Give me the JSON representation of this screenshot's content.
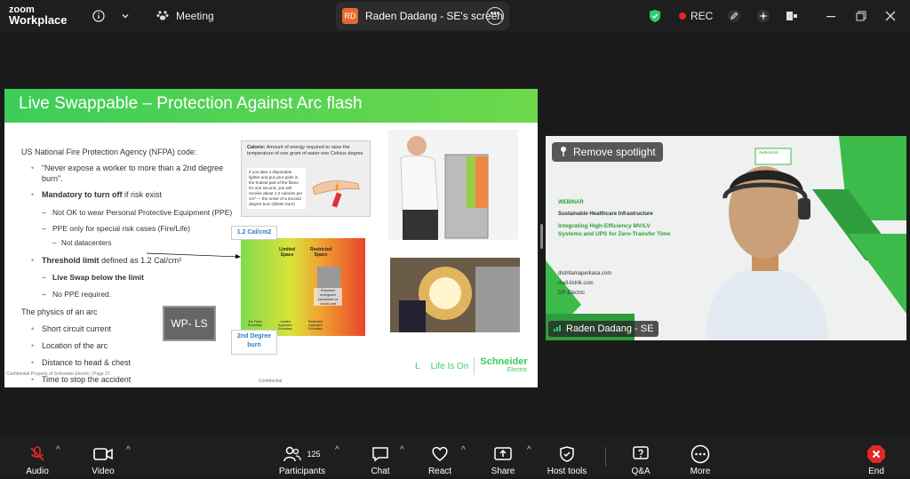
{
  "app": {
    "logo_line1": "zoom",
    "logo_line2": "Workplace",
    "meeting_label": "Meeting"
  },
  "screen_share": {
    "badge": "RD",
    "title": "Raden Dadang - SE's screen"
  },
  "recording": {
    "label": "REC"
  },
  "slide": {
    "title": "Live Swappable – Protection Against Arc flash",
    "lines": {
      "nfpa": "US National Fire Protection Agency (NFPA) code:",
      "never_expose": "“Never expose a worker to more than a 2nd degree",
      "burn": "burn”.",
      "mandatory_bold": "Mandatory",
      "turn_off_bold": "to turn off",
      "turn_off_rest": "if risk exist",
      "not_ok_ppe": "Not OK to wear Personal Protective Equipment (PPE)",
      "ppe_only": "PPE only for special risk cases (Fire/Life)",
      "not_datacenters": "Not datacenters",
      "threshold_bold": "Threshold limit",
      "threshold_rest": "defined as 1.2 Cal/cm²",
      "live_swap": "Live Swap below the limit",
      "no_ppe": "No PPE required.",
      "physics": "The physics of an arc",
      "short_circuit": "Short circuit current",
      "location": "Location of the arc",
      "distance": "Distance to head & chest",
      "time": "Time to stop the accident",
      "confidential_prop": "Confidential Property of Schneider Electric | Page 27",
      "confidential": "Confidential"
    },
    "calorie_box": {
      "title_bold": "Calorie:",
      "title_rest": "Amount of energy required to raise the temperature of one gram of water one Celsius degree",
      "body": "If you take a disposable lighter and put your palm in the hottest part of the flame for one second, you will receive about 1.2 calories per cm² — the onset of a second degree burn (blister burn)"
    },
    "arc_diagram": {
      "label_top": "1.2 Cal/cm2",
      "label_bottom": "2nd Degree burn",
      "zone_limited": "Limited Space",
      "zone_restricted": "Restricted Space",
      "exposed_text": "Exposed energized conductor or circuit part",
      "bottom_labels": [
        "Arc Flash Boundary",
        "Limited Approach Boundary",
        "Restricted Approach Boundary"
      ]
    },
    "wp_button": "WP- LS",
    "footer": {
      "life_is_on": "Life Is On",
      "brand": "Schneider",
      "brand_sub": "Electric"
    }
  },
  "video": {
    "spotlight_button": "Remove spotlight",
    "participant_name": "Raden Dadang - SE",
    "bg_slide": {
      "authorized": "Authorized",
      "webinar": "WEBINAR",
      "subtitle": "Sustainable Healthcare Infrastructure",
      "headline1": "Integrating High-Efficiency MV/LV",
      "headline2": "Systems and UPS for Zero-Transfer Time",
      "site1": "distritamaperkasa.com",
      "site2": "mall-listrik.com",
      "site3": "DP-Electric"
    }
  },
  "toolbar": {
    "audio": "Audio",
    "video": "Video",
    "participants": "Participants",
    "participants_count": "125",
    "chat": "Chat",
    "react": "React",
    "share": "Share",
    "host_tools": "Host tools",
    "qa": "Q&A",
    "more": "More",
    "end": "End"
  },
  "colors": {
    "accent_green": "#3dcd58",
    "rec_red": "#e02828",
    "badge_orange": "#e46a2c",
    "end_red": "#e02828"
  }
}
